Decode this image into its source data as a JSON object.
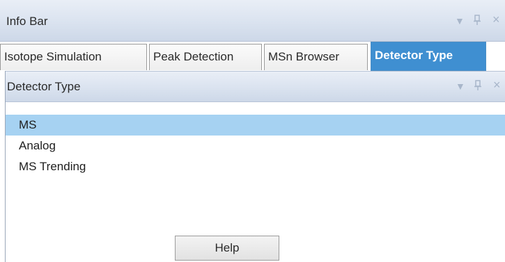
{
  "info_bar": {
    "title": "Info Bar",
    "controls": [
      {
        "icon": "dropdown-arrow-icon",
        "glyph": "▾"
      },
      {
        "icon": "pin-icon",
        "glyph": "ꟸ"
      },
      {
        "icon": "close-icon",
        "glyph": "×"
      }
    ]
  },
  "tabs": [
    {
      "label": "Isotope Simulation",
      "active": false
    },
    {
      "label": "Peak Detection",
      "active": false
    },
    {
      "label": "MSn Browser",
      "active": false
    },
    {
      "label": "Detector Type",
      "active": true
    }
  ],
  "detector_panel": {
    "title": "Detector Type",
    "items": [
      {
        "label": "MS",
        "selected": true
      },
      {
        "label": "Analog",
        "selected": false
      },
      {
        "label": "MS Trending",
        "selected": false
      }
    ],
    "help_label": "Help"
  },
  "colors": {
    "active_tab": "#3f8fd1",
    "selection": "#a6d2f2",
    "header_gradient_top": "#e9eef6",
    "header_gradient_bottom": "#cdd8e8"
  }
}
